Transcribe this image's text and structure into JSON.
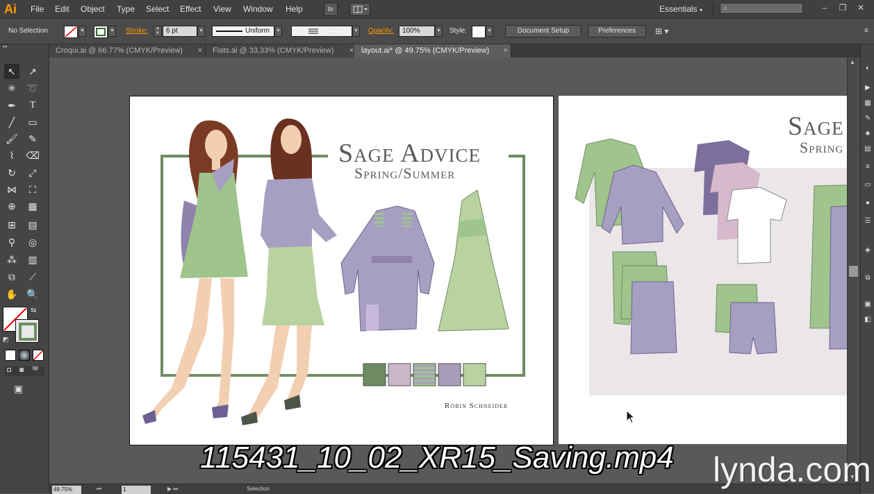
{
  "app": {
    "logo": "Ai",
    "menus": [
      "File",
      "Edit",
      "Object",
      "Type",
      "Select",
      "Effect",
      "View",
      "Window",
      "Help"
    ],
    "menu_buttons": [
      "Br"
    ],
    "workspace": "Essentials",
    "search_placeholder": "",
    "window_controls": [
      "–",
      "❐",
      "✕"
    ]
  },
  "control": {
    "selection": "No Selection",
    "stroke_label": "Stroke:",
    "stroke_weight": "6 pt",
    "stroke_profile": "Uniform",
    "opacity_label": "Opacity:",
    "opacity_value": "100%",
    "style_label": "Style:",
    "document_setup": "Document Setup",
    "preferences": "Preferences"
  },
  "tabs": [
    {
      "label": "Croqui.ai @ 66.77% (CMYK/Preview)",
      "close": "×"
    },
    {
      "label": "Flats.ai @ 33.33% (CMYK/Preview)",
      "close": "×"
    },
    {
      "label": "layout.ai* @ 49.75% (CMYK/Preview)",
      "close": "×",
      "active": true
    }
  ],
  "tools": [
    [
      "selection-icon",
      "direct-selection-icon"
    ],
    [
      "magic-wand-icon",
      "lasso-icon"
    ],
    [
      "pen-icon",
      "type-icon"
    ],
    [
      "line-icon",
      "rectangle-icon"
    ],
    [
      "paintbrush-icon",
      "pencil-icon"
    ],
    [
      "blob-brush-icon",
      "eraser-icon"
    ],
    [
      "rotate-icon",
      "scale-icon"
    ],
    [
      "width-icon",
      "free-transform-icon"
    ],
    [
      "shape-builder-icon",
      "perspective-grid-icon"
    ],
    [
      "mesh-icon",
      "gradient-icon"
    ],
    [
      "eyedropper-icon",
      "blend-icon"
    ],
    [
      "symbol-sprayer-icon",
      "column-graph-icon"
    ],
    [
      "artboard-icon",
      "slice-icon"
    ],
    [
      "hand-icon",
      "zoom-icon"
    ]
  ],
  "artboard1": {
    "title": "Sage Advice",
    "subtitle": "Spring/Summer",
    "designer": "Robin Schneider",
    "swatches": [
      "#6d8a60",
      "#c9b7c9",
      "striped",
      "#a79db8",
      "#b8d3a0"
    ]
  },
  "artboard2": {
    "title": "Sage",
    "subtitle": "Spring"
  },
  "status": {
    "zoom": "49.75%",
    "page": "1",
    "tool": "Selection"
  },
  "overlay": {
    "filename": "115431_10_02_XR15_Saving.mp4",
    "brand": "lynda.com"
  },
  "colors": {
    "sage_green": "#9fc48c",
    "lavender": "#a79fc2",
    "frame_green": "#6e8c64",
    "accent_orange": "#ff9a00"
  }
}
